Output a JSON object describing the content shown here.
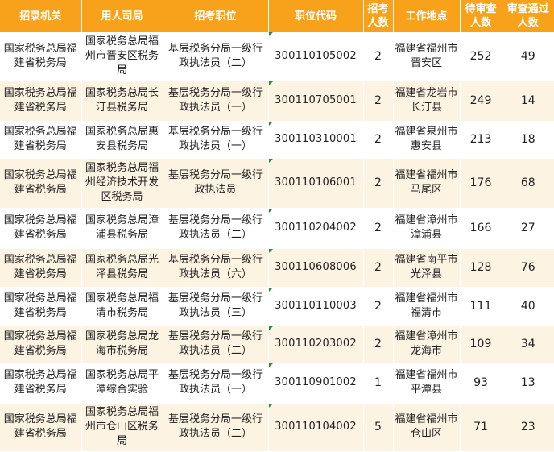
{
  "headers": [
    "招录机关",
    "用人司局",
    "招考职位",
    "职位代码",
    "招考\n人数",
    "工作地点",
    "待审查\n人数",
    "审查通过\n人数"
  ],
  "rows": [
    {
      "org": "国家税务总局福建省税务局",
      "dept": "国家税务总局福州市晋安区税务局",
      "position": "基层税务分局一级行政执法员（二）",
      "code": "300110105002",
      "recruit": "2",
      "location": "福建省福州市晋安区",
      "pending": "252",
      "passed": "49"
    },
    {
      "org": "国家税务总局福建省税务局",
      "dept": "国家税务总局长汀县税务局",
      "position": "基层税务分局一级行政执法员（一）",
      "code": "300110705001",
      "recruit": "2",
      "location": "福建省龙岩市长汀县",
      "pending": "249",
      "passed": "14"
    },
    {
      "org": "国家税务总局福建省税务局",
      "dept": "国家税务总局惠安县税务局",
      "position": "基层税务分局一级行政执法员（一）",
      "code": "300110310001",
      "recruit": "2",
      "location": "福建省泉州市惠安县",
      "pending": "213",
      "passed": "18"
    },
    {
      "org": "国家税务总局福建省税务局",
      "dept": "国家税务总局福州经济技术开发区税务局",
      "position": "基层税务分局一级行政执法员",
      "code": "300110106001",
      "recruit": "2",
      "location": "福建省福州市马尾区",
      "pending": "176",
      "passed": "68"
    },
    {
      "org": "国家税务总局福建省税务局",
      "dept": "国家税务总局漳浦县税务局",
      "position": "基层税务分局一级行政执法员（二）",
      "code": "300110204002",
      "recruit": "2",
      "location": "福建省漳州市漳浦县",
      "pending": "166",
      "passed": "27"
    },
    {
      "org": "国家税务总局福建省税务局",
      "dept": "国家税务总局光泽县税务局",
      "position": "基层税务分局一级行政执法员（六）",
      "code": "300110608006",
      "recruit": "2",
      "location": "福建省南平市光泽县",
      "pending": "128",
      "passed": "76"
    },
    {
      "org": "国家税务总局福建省税务局",
      "dept": "国家税务总局福清市税务局",
      "position": "基层税务分局一级行政执法员（三）",
      "code": "300110110003",
      "recruit": "2",
      "location": "福建省福州市福清市",
      "pending": "111",
      "passed": "40"
    },
    {
      "org": "国家税务总局福建省税务局",
      "dept": "国家税务总局龙海市税务局",
      "position": "基层税务分局一级行政执法员（二）",
      "code": "300110203002",
      "recruit": "2",
      "location": "福建省漳州市龙海市",
      "pending": "109",
      "passed": "34"
    },
    {
      "org": "国家税务总局福建省税务局",
      "dept": "国家税务总局平潭综合实验",
      "position": "基层税务分局一级行政执法员（一）",
      "code": "300110901002",
      "recruit": "1",
      "location": "福建省福州市平潭县",
      "pending": "93",
      "passed": "13"
    },
    {
      "org": "国家税务总局福建省税务局",
      "dept": "国家税务总局福州市仓山区税务局",
      "position": "基层税务分局一级行政执法员（二）",
      "code": "300110104002",
      "recruit": "5",
      "location": "福建省福州市仓山区",
      "pending": "71",
      "passed": "23"
    }
  ]
}
